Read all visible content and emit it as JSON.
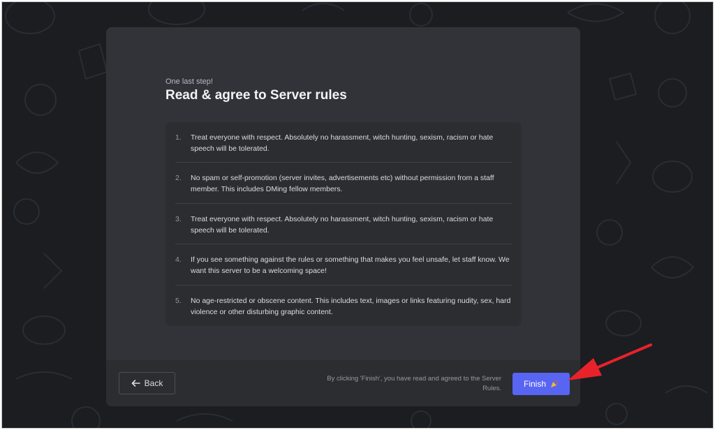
{
  "onboarding": {
    "eyebrow": "One last step!",
    "title": "Read & agree to Server rules"
  },
  "rules": [
    {
      "number": "1.",
      "text": "Treat everyone with respect. Absolutely no harassment, witch hunting, sexism, racism or hate speech will be tolerated."
    },
    {
      "number": "2.",
      "text": "No spam or self-promotion (server invites, advertisements etc) without permission from a staff member. This includes DMing fellow members."
    },
    {
      "number": "3.",
      "text": "Treat everyone with respect. Absolutely no harassment, witch hunting, sexism, racism or hate speech will be tolerated."
    },
    {
      "number": "4.",
      "text": "If you see something against the rules or something that makes you feel unsafe, let staff know. We want this server to be a welcoming space!"
    },
    {
      "number": "5.",
      "text": "No age-restricted or obscene content. This includes text, images or links featuring nudity, sex, hard violence or other disturbing graphic content."
    }
  ],
  "footer": {
    "back_label": "Back",
    "notice": "By clicking 'Finish', you have read and agreed to the Server Rules.",
    "finish_label": "Finish"
  },
  "colors": {
    "accent": "#5865f2",
    "annotation_arrow": "#e8222a",
    "background": "#1b1d21",
    "modal": "#313338"
  },
  "icons": {
    "back": "arrow-left-icon",
    "finish": "party-popper-icon"
  }
}
